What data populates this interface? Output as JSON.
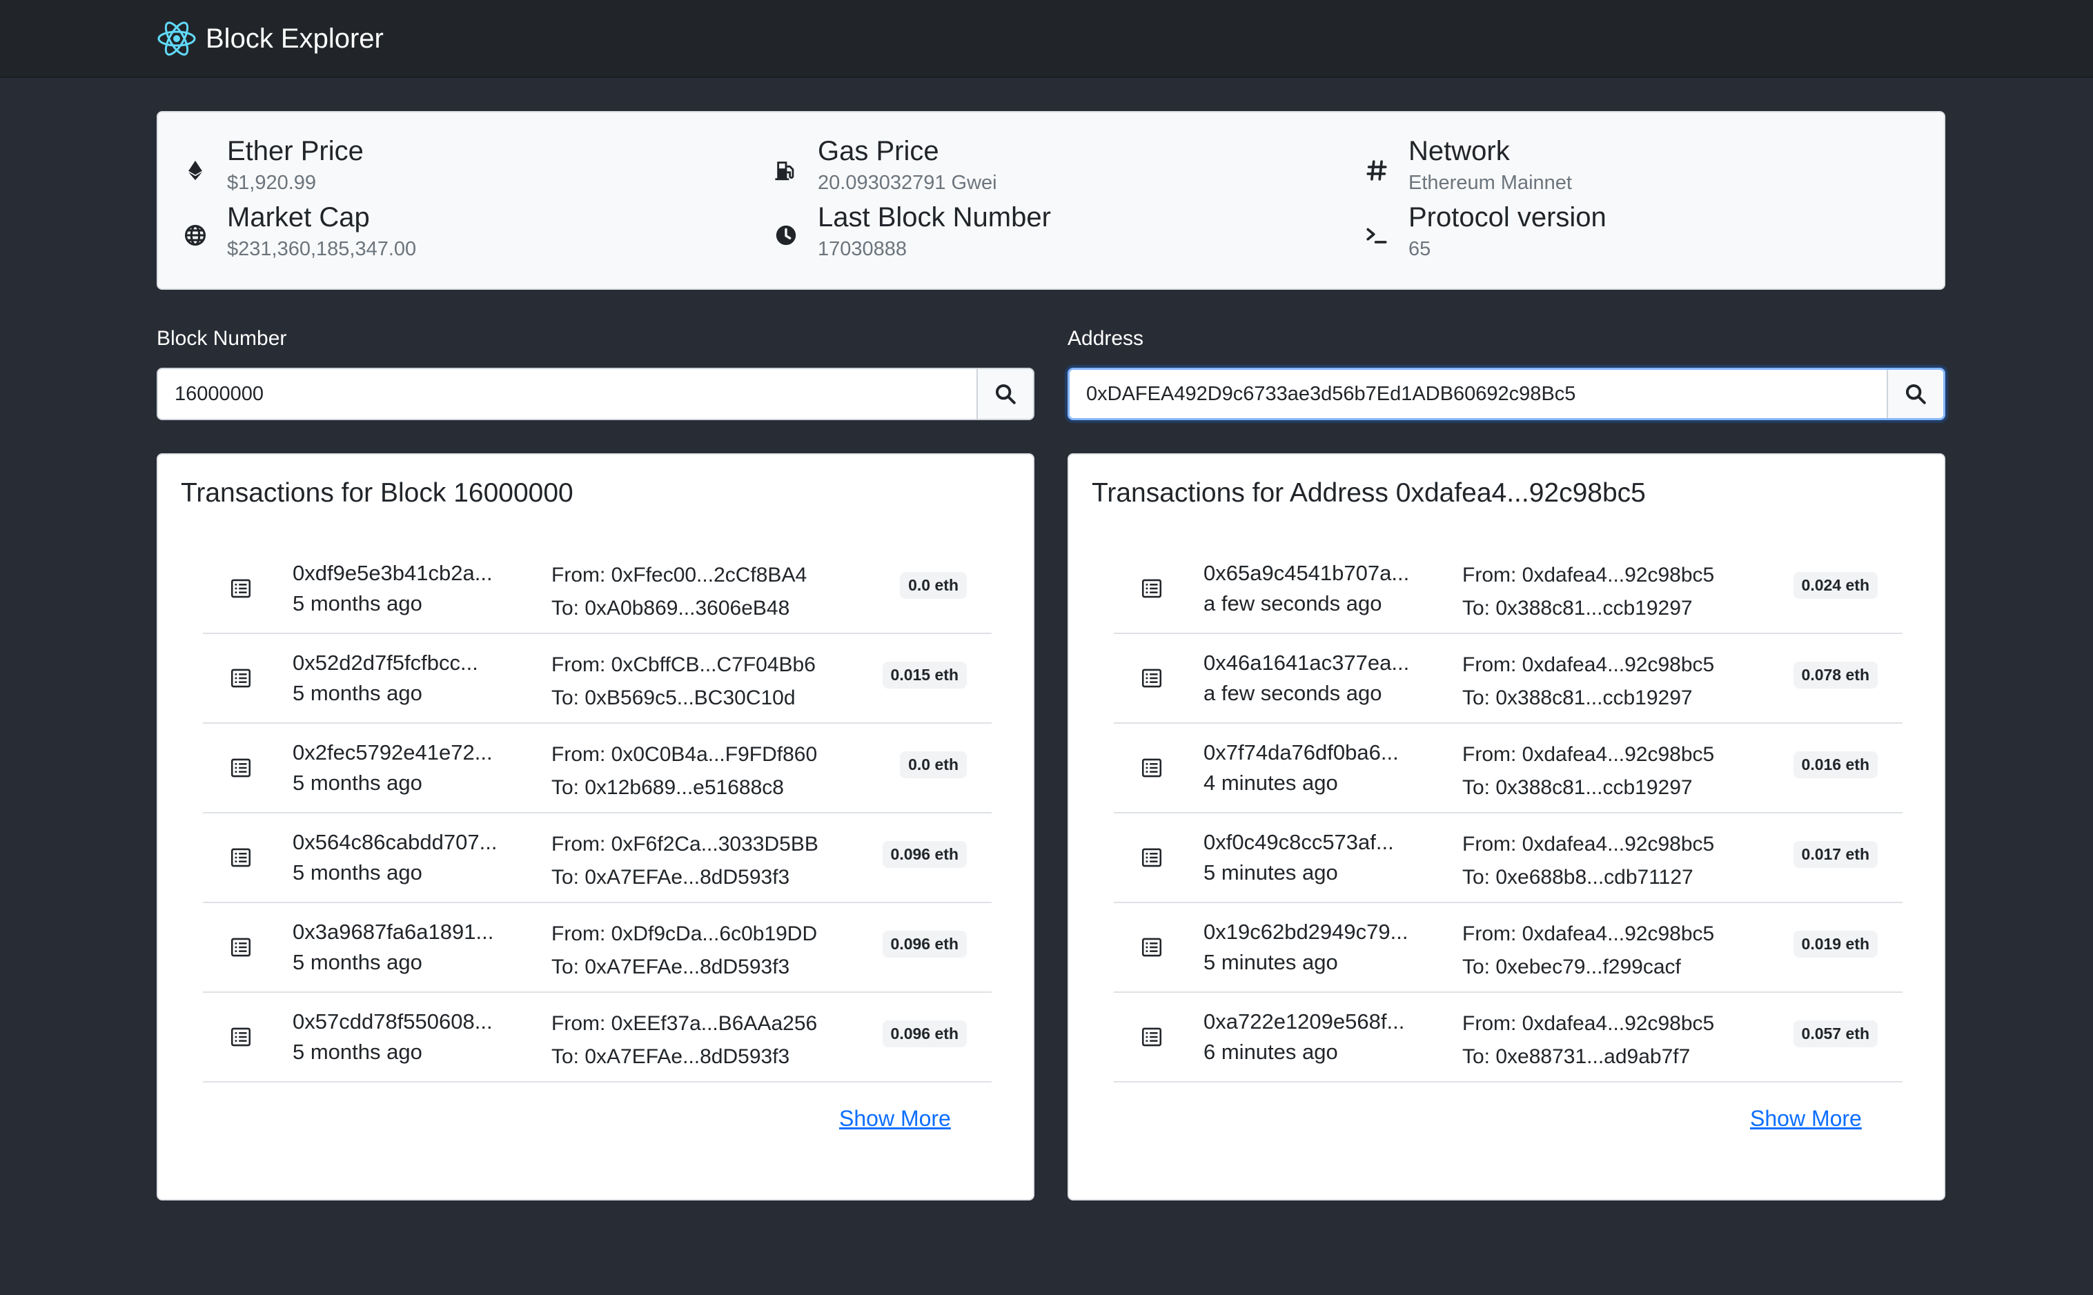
{
  "app": {
    "title": "Block Explorer",
    "logo_icon": "react-atom-icon",
    "accent": "#61dafb"
  },
  "stats": {
    "ether_price": {
      "label": "Ether Price",
      "value": "$1,920.99",
      "icon": "ethereum-icon"
    },
    "market_cap": {
      "label": "Market Cap",
      "value": "$231,360,185,347.00",
      "icon": "globe-icon"
    },
    "gas_price": {
      "label": "Gas Price",
      "value": "20.093032791 Gwei",
      "icon": "gas-pump-icon"
    },
    "last_block": {
      "label": "Last Block Number",
      "value": "17030888",
      "icon": "clock-icon"
    },
    "network": {
      "label": "Network",
      "value": "Ethereum Mainnet",
      "icon": "hash-icon"
    },
    "protocol": {
      "label": "Protocol version",
      "value": "65",
      "icon": "terminal-icon"
    }
  },
  "block_search": {
    "label": "Block Number",
    "value": "16000000"
  },
  "address_search": {
    "label": "Address",
    "value": "0xDAFEA492D9c6733ae3d56b7Ed1ADB60692c98Bc5"
  },
  "block_panel": {
    "title": "Transactions for Block 16000000",
    "show_more": "Show More",
    "transactions": [
      {
        "hash": "0xdf9e5e3b41cb2a...",
        "age": "5 months ago",
        "from": "From: 0xFfec00...2cCf8BA4",
        "to": "To: 0xA0b869...3606eB48",
        "amount": "0.0 eth"
      },
      {
        "hash": "0x52d2d7f5fcfbcc...",
        "age": "5 months ago",
        "from": "From: 0xCbffCB...C7F04Bb6",
        "to": "To: 0xB569c5...BC30C10d",
        "amount": "0.015 eth"
      },
      {
        "hash": "0x2fec5792e41e72...",
        "age": "5 months ago",
        "from": "From: 0x0C0B4a...F9FDf860",
        "to": "To: 0x12b689...e51688c8",
        "amount": "0.0 eth"
      },
      {
        "hash": "0x564c86cabdd707...",
        "age": "5 months ago",
        "from": "From: 0xF6f2Ca...3033D5BB",
        "to": "To: 0xA7EFAe...8dD593f3",
        "amount": "0.096 eth"
      },
      {
        "hash": "0x3a9687fa6a1891...",
        "age": "5 months ago",
        "from": "From: 0xDf9cDa...6c0b19DD",
        "to": "To: 0xA7EFAe...8dD593f3",
        "amount": "0.096 eth"
      },
      {
        "hash": "0x57cdd78f550608...",
        "age": "5 months ago",
        "from": "From: 0xEEf37a...B6AAa256",
        "to": "To: 0xA7EFAe...8dD593f3",
        "amount": "0.096 eth"
      }
    ]
  },
  "address_panel": {
    "title": "Transactions for Address 0xdafea4...92c98bc5",
    "show_more": "Show More",
    "transactions": [
      {
        "hash": "0x65a9c4541b707a...",
        "age": "a few seconds ago",
        "from": "From: 0xdafea4...92c98bc5",
        "to": "To: 0x388c81...ccb19297",
        "amount": "0.024 eth"
      },
      {
        "hash": "0x46a1641ac377ea...",
        "age": "a few seconds ago",
        "from": "From: 0xdafea4...92c98bc5",
        "to": "To: 0x388c81...ccb19297",
        "amount": "0.078 eth"
      },
      {
        "hash": "0x7f74da76df0ba6...",
        "age": "4 minutes ago",
        "from": "From: 0xdafea4...92c98bc5",
        "to": "To: 0x388c81...ccb19297",
        "amount": "0.016 eth"
      },
      {
        "hash": "0xf0c49c8cc573af...",
        "age": "5 minutes ago",
        "from": "From: 0xdafea4...92c98bc5",
        "to": "To: 0xe688b8...cdb71127",
        "amount": "0.017 eth"
      },
      {
        "hash": "0x19c62bd2949c79...",
        "age": "5 minutes ago",
        "from": "From: 0xdafea4...92c98bc5",
        "to": "To: 0xebec79...f299cacf",
        "amount": "0.019 eth"
      },
      {
        "hash": "0xa722e1209e568f...",
        "age": "6 minutes ago",
        "from": "From: 0xdafea4...92c98bc5",
        "to": "To: 0xe88731...ad9ab7f7",
        "amount": "0.057 eth"
      }
    ]
  }
}
